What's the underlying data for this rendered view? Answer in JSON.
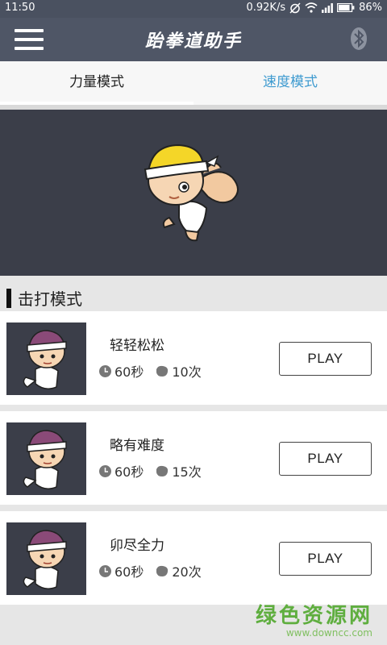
{
  "status_bar": {
    "time": "11:50",
    "network_speed": "0.92K/s",
    "battery": "86%"
  },
  "app_bar": {
    "title": "跆拳道助手",
    "menu_icon": "hamburger-menu-icon",
    "bluetooth_icon": "bluetooth-icon"
  },
  "tabs": [
    {
      "label": "力量模式",
      "selected": true
    },
    {
      "label": "速度模式",
      "selected": false
    }
  ],
  "section": {
    "title": "击打模式"
  },
  "modes": [
    {
      "name": "轻轻松松",
      "duration": "60秒",
      "hits": "10次",
      "button": "PLAY"
    },
    {
      "name": "略有难度",
      "duration": "60秒",
      "hits": "15次",
      "button": "PLAY"
    },
    {
      "name": "卯尽全力",
      "duration": "60秒",
      "hits": "20次",
      "button": "PLAY"
    }
  ],
  "watermark": {
    "main": "绿色资源网",
    "sub": "www.downcc.com"
  },
  "colors": {
    "app_bar": "#4f5666",
    "active_tab_text": "#222222",
    "inactive_tab_text": "#3f9bd0",
    "hero_background": "#3b3e49",
    "watermark": "#5fae3f"
  }
}
